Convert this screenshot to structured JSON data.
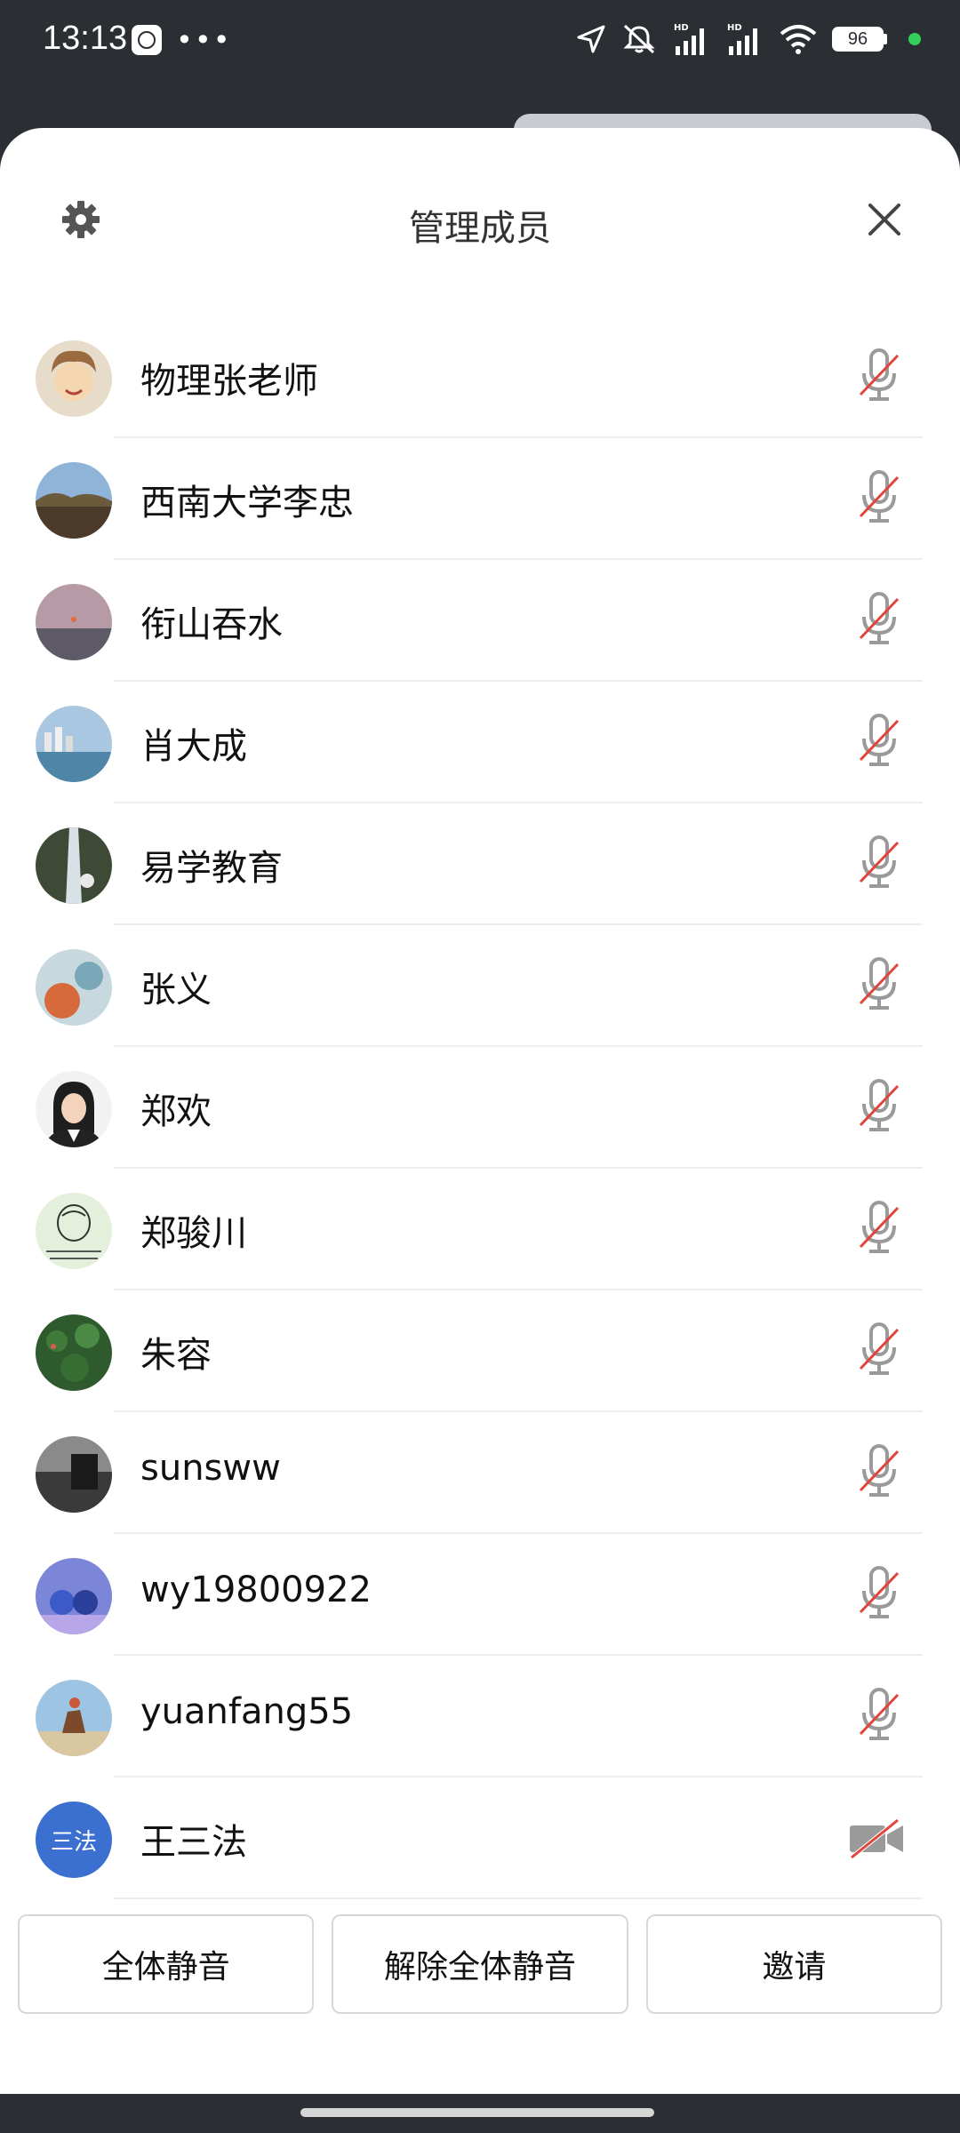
{
  "status_bar": {
    "time": "13:13",
    "battery": "96",
    "icons": [
      "clock-app-icon",
      "more-dots-icon",
      "location-icon",
      "vibrate-off-icon",
      "signal-hd-icon",
      "signal-hd-icon",
      "wifi-icon",
      "battery-icon",
      "active-dot"
    ]
  },
  "sheet": {
    "title": "管理成员",
    "settings_icon": "gear-icon",
    "close_icon": "close-icon"
  },
  "members": [
    {
      "name": "物理张老师",
      "status_icon": "mic-muted-icon"
    },
    {
      "name": "西南大学李忠",
      "status_icon": "mic-muted-icon"
    },
    {
      "name": "衔山吞水",
      "status_icon": "mic-muted-icon"
    },
    {
      "name": "肖大成",
      "status_icon": "mic-muted-icon"
    },
    {
      "name": "易学教育",
      "status_icon": "mic-muted-icon"
    },
    {
      "name": "张义",
      "status_icon": "mic-muted-icon"
    },
    {
      "name": "郑欢",
      "status_icon": "mic-muted-icon"
    },
    {
      "name": "郑骏川",
      "status_icon": "mic-muted-icon"
    },
    {
      "name": "朱容",
      "status_icon": "mic-muted-icon"
    },
    {
      "name": "sunsww",
      "status_icon": "mic-muted-icon"
    },
    {
      "name": "wy19800922",
      "status_icon": "mic-muted-icon"
    },
    {
      "name": "yuanfang55",
      "status_icon": "mic-muted-icon"
    },
    {
      "name": "王三法",
      "avatar_text": "三法",
      "status_icon": "camera-off-icon"
    }
  ],
  "actions": {
    "mute_all": "全体静音",
    "unmute_all": "解除全体静音",
    "invite": "邀请"
  },
  "colors": {
    "accent_avatar": "#3b6fd0",
    "muted_slash": "#e0453a",
    "icon_gray": "#9a9a9a"
  }
}
